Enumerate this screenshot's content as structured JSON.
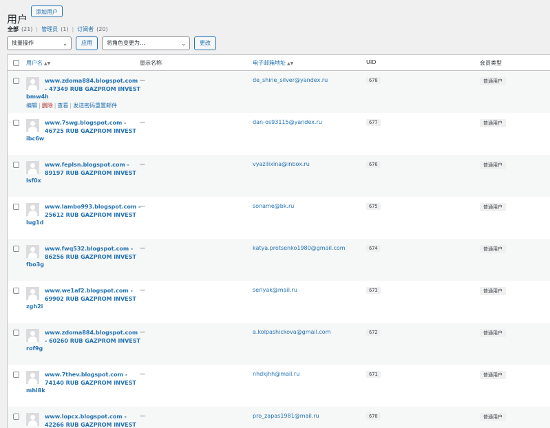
{
  "page": {
    "title": "用户",
    "add_user_label": "添加用户"
  },
  "filters": [
    {
      "label": "全部",
      "count": "(21)",
      "current": true
    },
    {
      "label": "管理员",
      "count": "(1)",
      "current": false
    },
    {
      "label": "订阅者",
      "count": "(20)",
      "current": false
    }
  ],
  "toolbar": {
    "bulk_action": "批量操作",
    "apply_label": "应用",
    "role_change": "将角色变更为...",
    "change_label": "更改"
  },
  "columns": {
    "username": "用户名",
    "display_name": "显示名称",
    "email": "电子邮箱地址",
    "uid": "UID",
    "member_type": "会员类型"
  },
  "row_actions": {
    "edit": "编辑",
    "delete": "删除",
    "view": "查看",
    "reset": "发送密码重置邮件"
  },
  "users": [
    {
      "name": "www.zdoma884.blogspot.com - 47349 RUB GAZPROM INVEST",
      "login": "bmw4h",
      "display": "—",
      "email": "de_shine_silver@yandex.ru",
      "uid": "678",
      "type": "普通用户"
    },
    {
      "name": "www.7swg.blogspot.com - 46725 RUB GAZPROM INVEST",
      "login": "ibc6w",
      "display": "—",
      "email": "dan-os93115@yandex.ru",
      "uid": "677",
      "type": "普通用户"
    },
    {
      "name": "www.feplsn.blogspot.com - 89197 RUB GAZPROM INVEST",
      "login": "lsf0x",
      "display": "—",
      "email": "vyazilixina@inbox.ru",
      "uid": "676",
      "type": "普通用户"
    },
    {
      "name": "www.lambo993.blogspot.com - 25612 RUB GAZPROM INVEST",
      "login": "lug1d",
      "display": "—",
      "email": "soname@bk.ru",
      "uid": "675",
      "type": "普通用户"
    },
    {
      "name": "www.fwq532.blogspot.com - 86256 RUB GAZPROM INVEST",
      "login": "fbo3g",
      "display": "—",
      "email": "katya.protsenko1980@gmail.com",
      "uid": "674",
      "type": "普通用户"
    },
    {
      "name": "www.we1af2.blogspot.com - 69902 RUB GAZPROM INVEST",
      "login": "zgh2i",
      "display": "—",
      "email": "serlyak@mail.ru",
      "uid": "673",
      "type": "普通用户"
    },
    {
      "name": "www.zdoma884.blogspot.com - 60260 RUB GAZPROM INVEST",
      "login": "rof9g",
      "display": "—",
      "email": "a.kolpashickova@gmail.com",
      "uid": "672",
      "type": "普通用户"
    },
    {
      "name": "www.7thev.blogspot.com - 74140 RUB GAZPROM INVEST",
      "login": "mhl8k",
      "display": "—",
      "email": "nhdkjhh@mail.ru",
      "uid": "671",
      "type": "普通用户"
    },
    {
      "name": "www.lopcx.blogspot.com - 42266 RUB GAZPROM INVEST",
      "login": "",
      "display": "—",
      "email": "pro_zapas1981@mail.ru",
      "uid": "670",
      "type": "普通用户"
    }
  ]
}
